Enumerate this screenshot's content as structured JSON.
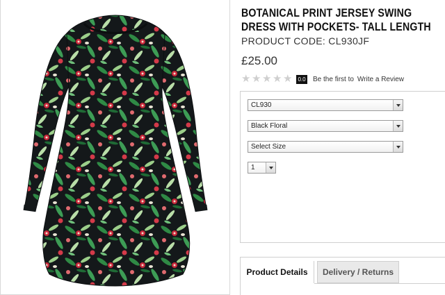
{
  "product": {
    "title_line1": "BOTANICAL PRINT JERSEY SWING",
    "title_line2": "DRESS WITH POCKETS- TALL LENGTH",
    "code": "PRODUCT CODE: CL930JF",
    "price": "£25.00"
  },
  "rating": {
    "stars_filled": 0,
    "stars_total": 5,
    "score": "0.0",
    "first_text": "Be the first to",
    "review_link": "Write a Review"
  },
  "options": {
    "style": "CL930",
    "colour": "Black Floral",
    "size": "Select Size",
    "quantity": "1"
  },
  "tabs": {
    "details": "Product Details",
    "delivery": "Delivery / Returns"
  },
  "icons": {
    "star": "star-icon",
    "dropdown": "chevron-down-icon"
  },
  "colors": {
    "print_base": "#14181a",
    "leaf_green": "#2f8a45",
    "leaf_light": "#9ccf8a",
    "flower_red": "#c8283a",
    "accent": "#111111"
  }
}
